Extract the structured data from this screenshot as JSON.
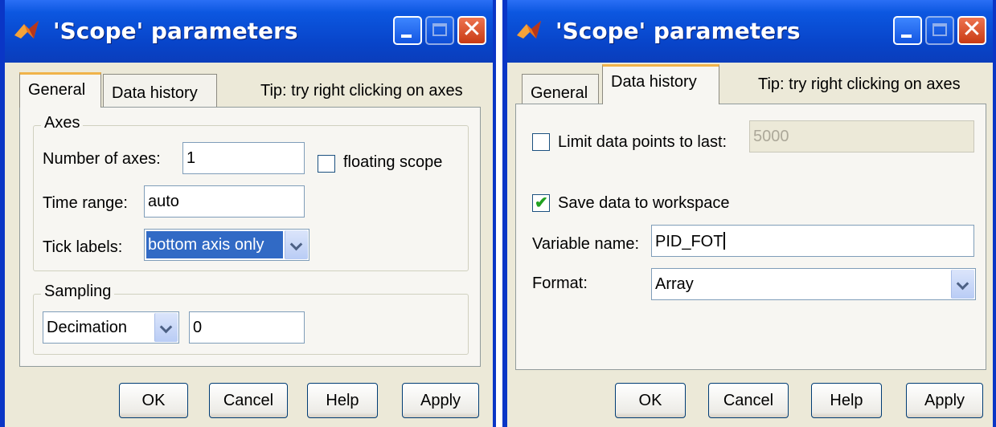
{
  "left_dialog": {
    "title": "'Scope' parameters",
    "tabs": [
      "General",
      "Data history"
    ],
    "active_tab": "General",
    "tip": "Tip: try right clicking on axes",
    "axes_group": {
      "label": "Axes",
      "num_axes_label": "Number of axes:",
      "num_axes_value": "1",
      "floating_scope_label": "floating scope",
      "floating_scope_checked": false,
      "time_range_label": "Time range:",
      "time_range_value": "auto",
      "tick_labels_label": "Tick labels:",
      "tick_labels_value": "bottom axis only"
    },
    "sampling_group": {
      "label": "Sampling",
      "mode_value": "Decimation",
      "factor_value": "0"
    },
    "buttons": [
      "OK",
      "Cancel",
      "Help",
      "Apply"
    ]
  },
  "right_dialog": {
    "title": "'Scope' parameters",
    "tabs": [
      "General",
      "Data history"
    ],
    "active_tab": "Data history",
    "tip": "Tip: try right clicking on axes",
    "limit_label": "Limit data points to last:",
    "limit_checked": false,
    "limit_value": "5000",
    "save_label": "Save data to workspace",
    "save_checked": true,
    "variable_name_label": "Variable name:",
    "variable_name_value": "PID_FOT",
    "format_label": "Format:",
    "format_value": "Array",
    "buttons": [
      "OK",
      "Cancel",
      "Help",
      "Apply"
    ]
  }
}
